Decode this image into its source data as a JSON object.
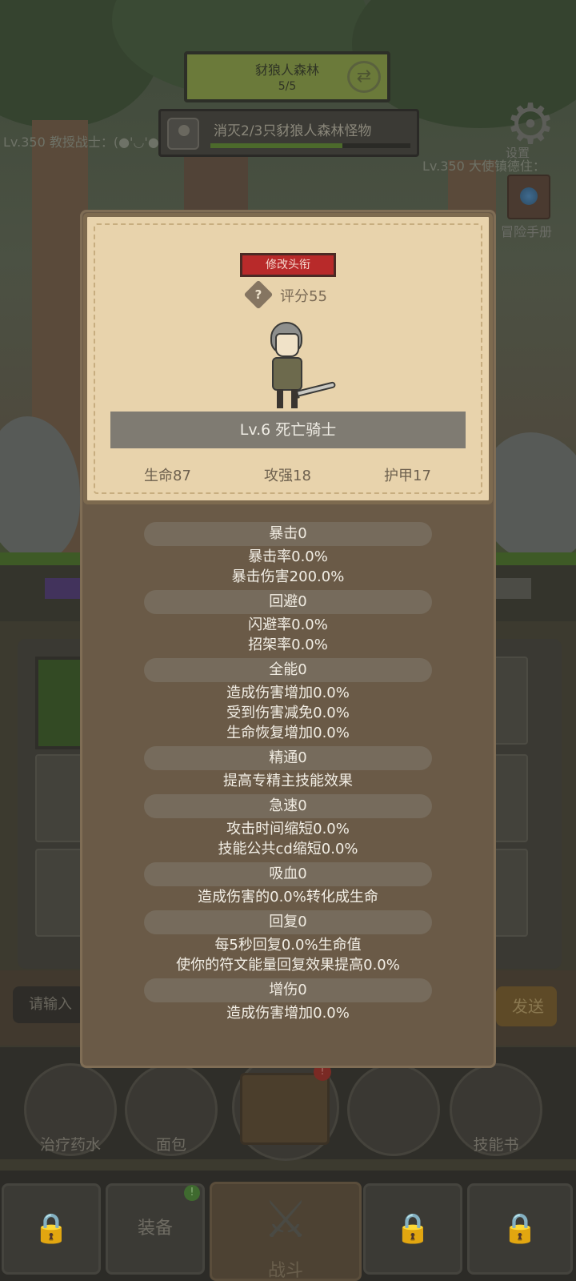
{
  "background": {
    "quest": {
      "name": "豺狼人森林",
      "progress": "5/5"
    },
    "task": {
      "text": "消灭2/3只豺狼人森林怪物",
      "progress": 0.66
    },
    "left_player": "Lv.350 教授战士：(●'◡'●",
    "right_player": "Lv.350 大使镇德住：",
    "settings_label": "设置",
    "manual_label": "冒险手册",
    "chat_placeholder": "请输入",
    "send_label": "发送",
    "items": [
      {
        "label": "治疗药水",
        "icon": "potion-icon"
      },
      {
        "label": "面包",
        "icon": "bread-icon"
      },
      {
        "label": "",
        "icon": "chest-icon",
        "badge": "!"
      },
      {
        "label": "",
        "icon": "lock-icon"
      },
      {
        "label": "技能书",
        "icon": "skill-book-icon"
      }
    ],
    "tabs": [
      {
        "label": "",
        "icon": "lock-icon"
      },
      {
        "label": "装备",
        "badge": "!"
      },
      {
        "label": "战斗",
        "icon": "crossed-swords-icon"
      },
      {
        "label": "",
        "icon": "lock-icon"
      },
      {
        "label": "",
        "icon": "lock-icon"
      }
    ]
  },
  "panel": {
    "title_button": "修改头衔",
    "help_icon_glyph": "?",
    "score": "评分55",
    "character_name": "Lv.6 死亡骑士",
    "base_stats": [
      "生命87",
      "攻强18",
      "护甲17"
    ],
    "sections": [
      {
        "header": "暴击0",
        "lines": [
          "暴击率0.0%",
          "暴击伤害200.0%"
        ]
      },
      {
        "header": "回避0",
        "lines": [
          "闪避率0.0%",
          "招架率0.0%"
        ]
      },
      {
        "header": "全能0",
        "lines": [
          "造成伤害增加0.0%",
          "受到伤害减免0.0%",
          "生命恢复增加0.0%"
        ]
      },
      {
        "header": "精通0",
        "lines": [
          "提高专精主技能效果"
        ]
      },
      {
        "header": "急速0",
        "lines": [
          "攻击时间缩短0.0%",
          "技能公共cd缩短0.0%"
        ]
      },
      {
        "header": "吸血0",
        "lines": [
          "造成伤害的0.0%转化成生命"
        ]
      },
      {
        "header": "回复0",
        "lines": [
          "每5秒回复0.0%生命值",
          "使你的符文能量回复效果提高0.0%"
        ]
      },
      {
        "header": "增伤0",
        "lines": [
          "造成伤害增加0.0%"
        ]
      }
    ]
  }
}
